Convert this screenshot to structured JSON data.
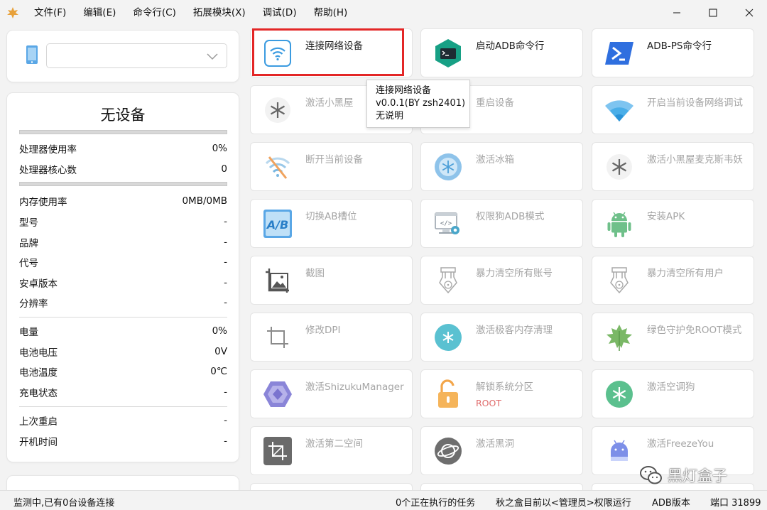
{
  "menu": {
    "items": [
      "文件(F)",
      "编辑(E)",
      "命令行(C)",
      "拓展模块(X)",
      "调试(D)",
      "帮助(H)"
    ]
  },
  "device": {
    "select_value": "",
    "name": "无设备"
  },
  "stats": {
    "cpu_usage_label": "处理器使用率",
    "cpu_usage_value": "0%",
    "cpu_cores_label": "处理器核心数",
    "cpu_cores_value": "0",
    "mem_label": "内存使用率",
    "mem_value": "0MB/0MB",
    "model_label": "型号",
    "model_value": "-",
    "brand_label": "品牌",
    "brand_value": "-",
    "code_label": "代号",
    "code_value": "-",
    "android_label": "安卓版本",
    "android_value": "-",
    "res_label": "分辨率",
    "res_value": "-",
    "battery_label": "电量",
    "battery_value": "0%",
    "voltage_label": "电池电压",
    "voltage_value": "0V",
    "temp_label": "电池温度",
    "temp_value": "0℃",
    "charge_label": "充电状态",
    "charge_value": "-",
    "reboot_label": "上次重启",
    "reboot_value": "-",
    "uptime_label": "开机时间",
    "uptime_value": "-"
  },
  "tiles": [
    {
      "label": "连接网络设备",
      "icon": "wifi-icon"
    },
    {
      "label": "启动ADB命令行",
      "icon": "terminal-icon"
    },
    {
      "label": "ADB-PS命令行",
      "icon": "powershell-icon"
    },
    {
      "label": "激活小黑屋",
      "icon": "snowflake-icon"
    },
    {
      "label": "重启设备",
      "icon": "reboot-icon"
    },
    {
      "label": "开启当前设备网络调试",
      "icon": "wifi-signal-icon"
    },
    {
      "label": "断开当前设备",
      "icon": "wifi-off-icon"
    },
    {
      "label": "激活冰箱",
      "icon": "ice-box-icon"
    },
    {
      "label": "激活小黑屋麦克斯韦妖",
      "icon": "snowflake-icon"
    },
    {
      "label": "切换AB槽位",
      "icon": "ab-slot-icon"
    },
    {
      "label": "权限狗ADB模式",
      "icon": "code-gear-icon"
    },
    {
      "label": "安装APK",
      "icon": "android-icon"
    },
    {
      "label": "截图",
      "icon": "screenshot-icon"
    },
    {
      "label": "暴力清空所有账号",
      "icon": "nuke-icon"
    },
    {
      "label": "暴力清空所有用户",
      "icon": "nuke-icon"
    },
    {
      "label": "修改DPI",
      "icon": "crop-icon"
    },
    {
      "label": "激活极客内存清理",
      "icon": "memory-clean-icon"
    },
    {
      "label": "绿色守护免ROOT模式",
      "icon": "leaf-icon"
    },
    {
      "label": "激活ShizukuManager",
      "icon": "shizuku-icon"
    },
    {
      "label": "解锁系统分区",
      "icon": "unlock-icon",
      "sub": "ROOT"
    },
    {
      "label": "激活空调狗",
      "icon": "snowflake-green-icon"
    },
    {
      "label": "激活第二空间",
      "icon": "crop-square-icon"
    },
    {
      "label": "激活黑洞",
      "icon": "blackhole-icon"
    },
    {
      "label": "激活FreezeYou",
      "icon": "freezeyou-icon"
    }
  ],
  "tooltip": {
    "line1": "连接网络设备",
    "line2": "v0.0.1(BY zsh2401)",
    "line3": "无说明"
  },
  "status": {
    "left": "监测中,已有0台设备连接",
    "tasks": "0个正在执行的任务",
    "privilege": "秋之盒目前以<管理员>权限运行",
    "adb": "ADB版本",
    "port": "端口 31899"
  },
  "watermark": "黑灯盒子",
  "colors": {
    "highlight": "#e32626",
    "root_label": "#e06c6c"
  }
}
